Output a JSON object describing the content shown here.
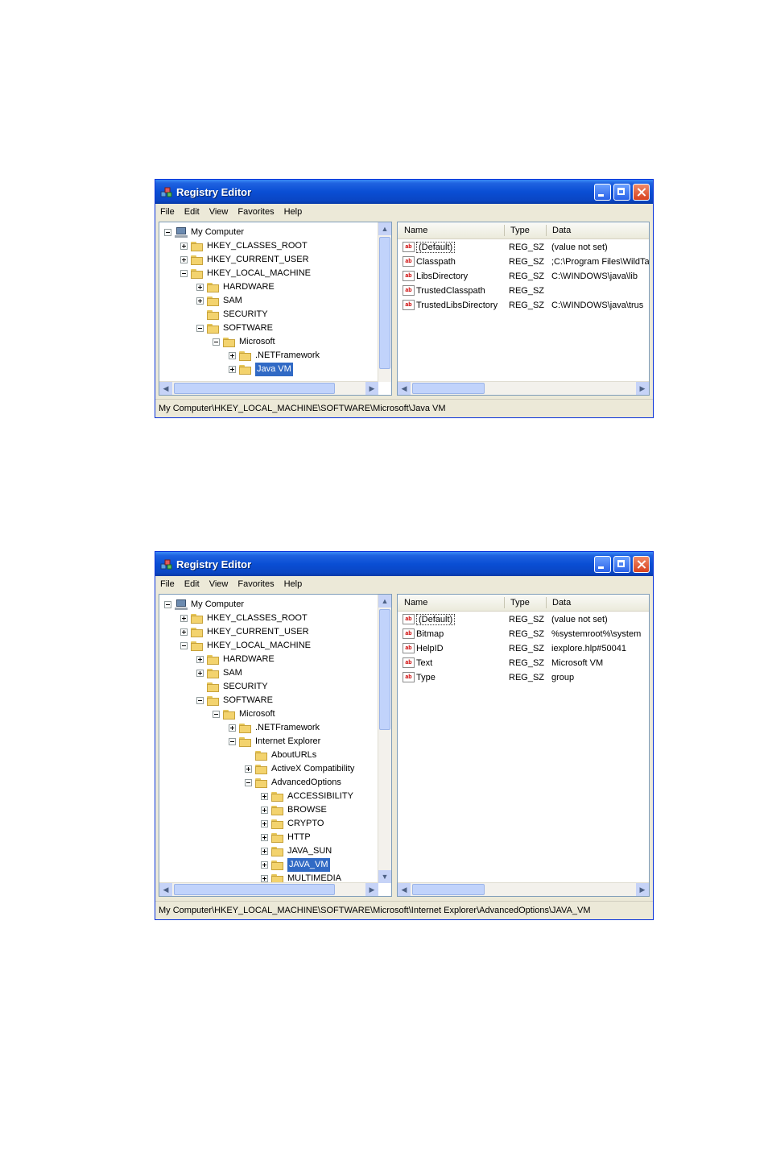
{
  "app_title": "Registry Editor",
  "menu": [
    "File",
    "Edit",
    "View",
    "Favorites",
    "Help"
  ],
  "columns": {
    "name": "Name",
    "type": "Type",
    "data": "Data"
  },
  "windows": [
    {
      "tree": [
        {
          "label": "My Computer",
          "level": 0,
          "exp": "minus",
          "icon": "computer"
        },
        {
          "label": "HKEY_CLASSES_ROOT",
          "level": 1,
          "exp": "plus",
          "icon": "folder"
        },
        {
          "label": "HKEY_CURRENT_USER",
          "level": 1,
          "exp": "plus",
          "icon": "folder"
        },
        {
          "label": "HKEY_LOCAL_MACHINE",
          "level": 1,
          "exp": "minus",
          "icon": "folder"
        },
        {
          "label": "HARDWARE",
          "level": 2,
          "exp": "plus",
          "icon": "folder"
        },
        {
          "label": "SAM",
          "level": 2,
          "exp": "plus",
          "icon": "folder"
        },
        {
          "label": "SECURITY",
          "level": 2,
          "exp": "none",
          "icon": "folder"
        },
        {
          "label": "SOFTWARE",
          "level": 2,
          "exp": "minus",
          "icon": "folder"
        },
        {
          "label": "Microsoft",
          "level": 3,
          "exp": "minus",
          "icon": "folder"
        },
        {
          "label": ".NETFramework",
          "level": 4,
          "exp": "plus",
          "icon": "folder"
        },
        {
          "label": "Java VM",
          "level": 4,
          "exp": "plus",
          "icon": "folder-open",
          "selected": true
        }
      ],
      "values": [
        {
          "name": "(Default)",
          "type": "REG_SZ",
          "data": "(value not set)"
        },
        {
          "name": "Classpath",
          "type": "REG_SZ",
          "data": ";C:\\Program Files\\WildTa"
        },
        {
          "name": "LibsDirectory",
          "type": "REG_SZ",
          "data": "C:\\WINDOWS\\java\\lib"
        },
        {
          "name": "TrustedClasspath",
          "type": "REG_SZ",
          "data": ""
        },
        {
          "name": "TrustedLibsDirectory",
          "type": "REG_SZ",
          "data": "C:\\WINDOWS\\java\\trus"
        }
      ],
      "status": "My Computer\\HKEY_LOCAL_MACHINE\\SOFTWARE\\Microsoft\\Java VM"
    },
    {
      "tree": [
        {
          "label": "My Computer",
          "level": 0,
          "exp": "minus",
          "icon": "computer"
        },
        {
          "label": "HKEY_CLASSES_ROOT",
          "level": 1,
          "exp": "plus",
          "icon": "folder"
        },
        {
          "label": "HKEY_CURRENT_USER",
          "level": 1,
          "exp": "plus",
          "icon": "folder"
        },
        {
          "label": "HKEY_LOCAL_MACHINE",
          "level": 1,
          "exp": "minus",
          "icon": "folder"
        },
        {
          "label": "HARDWARE",
          "level": 2,
          "exp": "plus",
          "icon": "folder"
        },
        {
          "label": "SAM",
          "level": 2,
          "exp": "plus",
          "icon": "folder"
        },
        {
          "label": "SECURITY",
          "level": 2,
          "exp": "none",
          "icon": "folder"
        },
        {
          "label": "SOFTWARE",
          "level": 2,
          "exp": "minus",
          "icon": "folder"
        },
        {
          "label": "Microsoft",
          "level": 3,
          "exp": "minus",
          "icon": "folder"
        },
        {
          "label": ".NETFramework",
          "level": 4,
          "exp": "plus",
          "icon": "folder"
        },
        {
          "label": "Internet Explorer",
          "level": 4,
          "exp": "minus",
          "icon": "folder"
        },
        {
          "label": "AboutURLs",
          "level": 5,
          "exp": "none",
          "icon": "folder"
        },
        {
          "label": "ActiveX Compatibility",
          "level": 5,
          "exp": "plus",
          "icon": "folder"
        },
        {
          "label": "AdvancedOptions",
          "level": 5,
          "exp": "minus",
          "icon": "folder"
        },
        {
          "label": "ACCESSIBILITY",
          "level": 6,
          "exp": "plus",
          "icon": "folder"
        },
        {
          "label": "BROWSE",
          "level": 6,
          "exp": "plus",
          "icon": "folder"
        },
        {
          "label": "CRYPTO",
          "level": 6,
          "exp": "plus",
          "icon": "folder"
        },
        {
          "label": "HTTP",
          "level": 6,
          "exp": "plus",
          "icon": "folder"
        },
        {
          "label": "JAVA_SUN",
          "level": 6,
          "exp": "plus",
          "icon": "folder"
        },
        {
          "label": "JAVA_VM",
          "level": 6,
          "exp": "plus",
          "icon": "folder-open",
          "selected": true
        },
        {
          "label": "MULTIMEDIA",
          "level": 6,
          "exp": "plus",
          "icon": "folder"
        }
      ],
      "values": [
        {
          "name": "(Default)",
          "type": "REG_SZ",
          "data": "(value not set)"
        },
        {
          "name": "Bitmap",
          "type": "REG_SZ",
          "data": "%systemroot%\\system"
        },
        {
          "name": "HelpID",
          "type": "REG_SZ",
          "data": "iexplore.hlp#50041"
        },
        {
          "name": "Text",
          "type": "REG_SZ",
          "data": "Microsoft VM"
        },
        {
          "name": "Type",
          "type": "REG_SZ",
          "data": "group"
        }
      ],
      "status": "My Computer\\HKEY_LOCAL_MACHINE\\SOFTWARE\\Microsoft\\Internet Explorer\\AdvancedOptions\\JAVA_VM"
    }
  ],
  "icons": {
    "app": "registry-editor-icon",
    "minimize": "minimize-icon",
    "maximize": "maximize-icon",
    "close": "close-icon",
    "folder": "folder-icon",
    "computer": "computer-icon",
    "string_value": "string-value-icon"
  },
  "colors": {
    "titlebar": "#0a4ed4",
    "selection": "#316ac5",
    "window_face": "#ece9d8",
    "close_button": "#d8421e"
  }
}
